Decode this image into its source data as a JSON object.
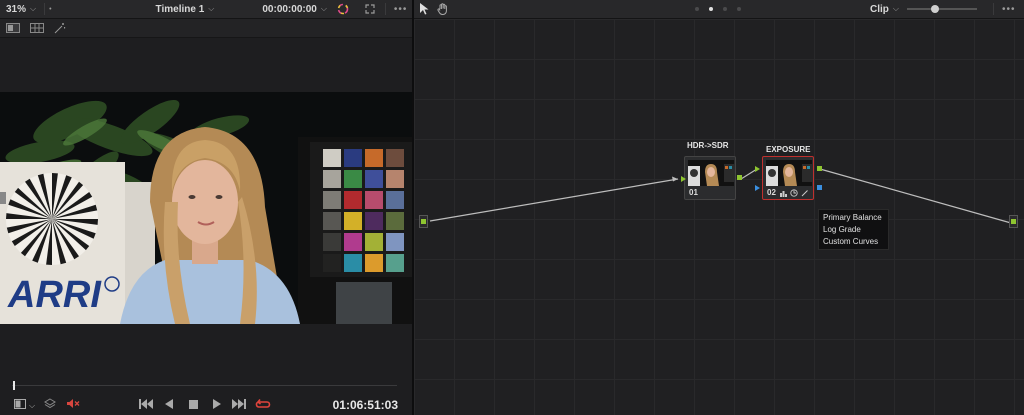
{
  "viewer": {
    "zoom": "31%",
    "timeline_name": "Timeline 1",
    "timecode_top": "00:00:00:00",
    "timecode_bottom": "01:06:51:03",
    "chart_labels": {
      "logo": "ARRI"
    }
  },
  "node_editor": {
    "mode": "Clip",
    "nodes": [
      {
        "label": "HDR->SDR",
        "number": "01"
      },
      {
        "label": "EXPOSURE",
        "number": "02"
      }
    ],
    "tooltip": [
      "Primary Balance",
      "Log Grade",
      "Custom Curves"
    ]
  },
  "colors": {
    "accent_red": "#c0302e",
    "port_green": "#8ec530",
    "port_blue": "#3a8fe0"
  }
}
